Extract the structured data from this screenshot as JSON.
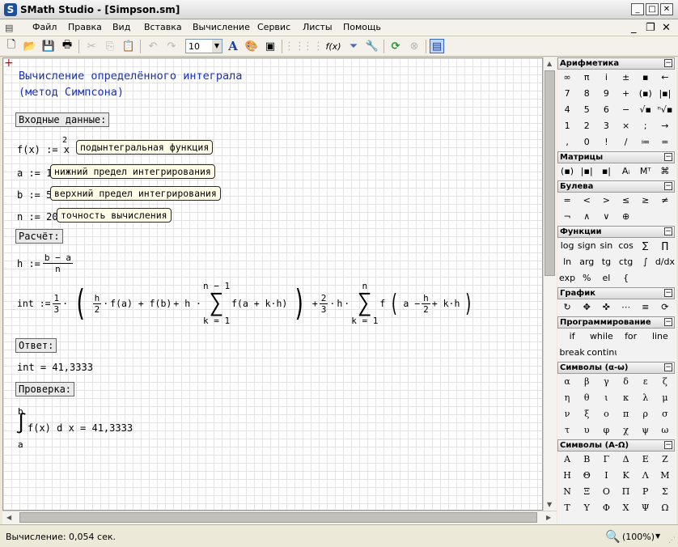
{
  "window": {
    "title": "SMath Studio - [Simpson.sm]",
    "app_icon": "S",
    "controls": {
      "minimize": "_",
      "maximize": "□",
      "close": "✕"
    }
  },
  "menu": {
    "items": [
      "Файл",
      "Правка",
      "Вид",
      "Вставка",
      "Вычисление",
      "Сервис",
      "Листы",
      "Помощь"
    ],
    "doc_controls": {
      "minimize": "_",
      "restore": "❐",
      "close": "✕"
    }
  },
  "toolbar": {
    "font_size": "10",
    "font_size_arrow": "▼",
    "glyphs": {
      "new": "🗋",
      "open": "📂",
      "save": "💾",
      "print": "🖶",
      "cut": "✂",
      "copy": "⎘",
      "paste": "📋",
      "undo": "↶",
      "redo": "↷",
      "text_style": "A",
      "color": "🎨",
      "border": "▣",
      "align": "⋮⋮",
      "function": "f(x)",
      "filter": "⏷",
      "tools": "🔧",
      "calculate": "⟳",
      "stop": "⊗",
      "pages": "▤"
    }
  },
  "worksheet": {
    "origin_marker": "+",
    "heading_line1": "Вычисление определённого интеграла",
    "heading_line2": "(метод Симпсона)",
    "input_header": "Входные данные:",
    "f_def": "f(x) := x",
    "f_exp": "2",
    "f_note": "подынтегральная функция",
    "a_def": "a := 1",
    "a_note": "нижний предел интегрирования",
    "b_def": "b := 5",
    "b_note": "верхний предел интегрирования",
    "n_def": "n := 20",
    "n_note": "точность вычисления",
    "calc_header": "Расчёт:",
    "h_lhs": "h :=",
    "h_num": "b − a",
    "h_den": "n",
    "int_lhs": "int :=",
    "one": "1",
    "two": "2",
    "three": "3",
    "h": "h",
    "dot": "·",
    "fa_plus_fb": "f(a) + f(b)",
    "plus_h": "+ h ·",
    "sum1_top": "n − 1",
    "sum1_bot": "k = 1",
    "sum_sign": "∑",
    "sum1_body": "f(a + k·h)",
    "plus": "+",
    "sum2_top": "n",
    "sum2_bot": "k = 1",
    "sum2_body_pre": "f",
    "a_minus": "a −",
    "plus_kh": "+ k·h",
    "answer_header": "Ответ:",
    "answer": "int = 41,3333",
    "check_header": "Проверка:",
    "integral_upper": "b",
    "integral_lower": "a",
    "integral_sign": "∫",
    "integral_body": "f(x) d x = 41,3333"
  },
  "panel": {
    "arith": {
      "title": "Арифметика",
      "cells": [
        "∞",
        "π",
        "i",
        "±",
        "▪",
        "←",
        "7",
        "8",
        "9",
        "+",
        "(▪)",
        "|▪|",
        "4",
        "5",
        "6",
        "−",
        "√▪",
        "ⁿ√▪",
        "1",
        "2",
        "3",
        "×",
        ";",
        "→",
        ",",
        "0",
        "!",
        "/",
        "≔",
        "="
      ]
    },
    "matrices": {
      "title": "Матрицы",
      "cells": [
        "(▪)",
        "|▪|",
        "▪|",
        "Aᵢ",
        "Mᵀ",
        "⌘"
      ]
    },
    "boolean": {
      "title": "Булева",
      "cells": [
        "=",
        "<",
        ">",
        "≤",
        "≥",
        "≠",
        "¬",
        "∧",
        "∨",
        "⊕"
      ]
    },
    "functions": {
      "title": "Функции",
      "cells": [
        "log",
        "sign",
        "sin",
        "cos",
        "∑",
        "∏",
        "ln",
        "arg",
        "tg",
        "ctg",
        "∫",
        "d/dx",
        "exp",
        "%",
        "el",
        "{"
      ]
    },
    "graph": {
      "title": "График",
      "cells": [
        "↻",
        "✥",
        "✜",
        "⋯",
        "≡",
        "⟳"
      ]
    },
    "programming": {
      "title": "Программирование",
      "cells": [
        "if",
        "while",
        "for",
        "line",
        "break",
        "continue"
      ]
    },
    "greek_lower": {
      "title": "Символы (α-ω)",
      "cells": [
        "α",
        "β",
        "γ",
        "δ",
        "ε",
        "ζ",
        "η",
        "θ",
        "ι",
        "κ",
        "λ",
        "μ",
        "ν",
        "ξ",
        "ο",
        "π",
        "ρ",
        "σ",
        "τ",
        "υ",
        "φ",
        "χ",
        "ψ",
        "ω"
      ]
    },
    "greek_upper": {
      "title": "Символы (Α-Ω)",
      "cells": [
        "Α",
        "Β",
        "Γ",
        "Δ",
        "Ε",
        "Ζ",
        "Η",
        "Θ",
        "Ι",
        "Κ",
        "Λ",
        "Μ",
        "Ν",
        "Ξ",
        "Ο",
        "Π",
        "Ρ",
        "Σ",
        "Τ",
        "Υ",
        "Φ",
        "Χ",
        "Ψ",
        "Ω"
      ]
    },
    "collapse_glyph": "−"
  },
  "status": {
    "text": "Вычисление: 0,054 сек.",
    "zoom": "(100%)",
    "zoom_arrow": "▼",
    "zoom_icon": "🔍",
    "grip": "⋰"
  },
  "scroll": {
    "up": "▲",
    "down": "▼",
    "left": "◀",
    "right": "▶"
  }
}
